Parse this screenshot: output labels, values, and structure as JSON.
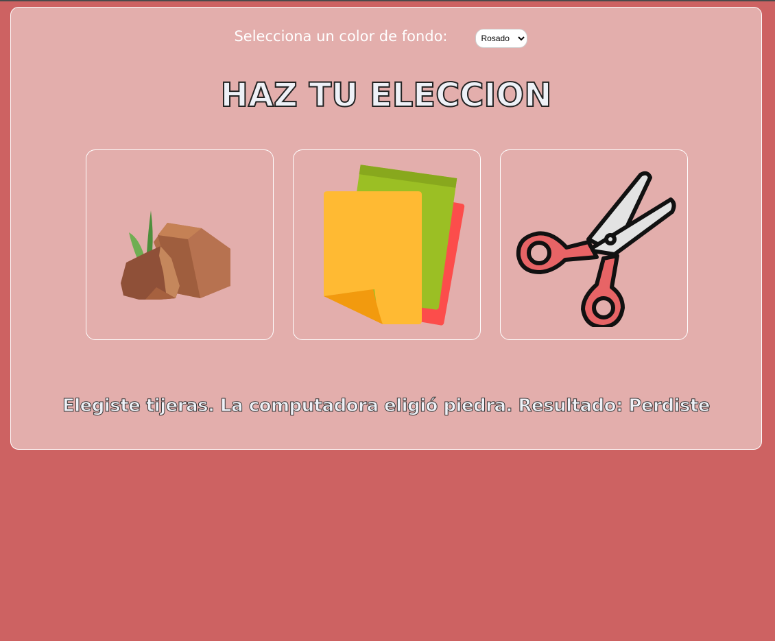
{
  "background": {
    "label": "Selecciona un color de fondo:",
    "selected": "Rosado",
    "options": [
      "Rosado"
    ],
    "page_color": "#cd6262",
    "panel_color": "#e3aeac"
  },
  "title": "HAZ TU ELECCION",
  "choices": [
    {
      "id": "piedra",
      "icon": "rock-icon"
    },
    {
      "id": "papel",
      "icon": "paper-icon"
    },
    {
      "id": "tijeras",
      "icon": "scissors-icon"
    }
  ],
  "result": "Elegiste tijeras. La computadora eligió piedra. Resultado: Perdiste"
}
